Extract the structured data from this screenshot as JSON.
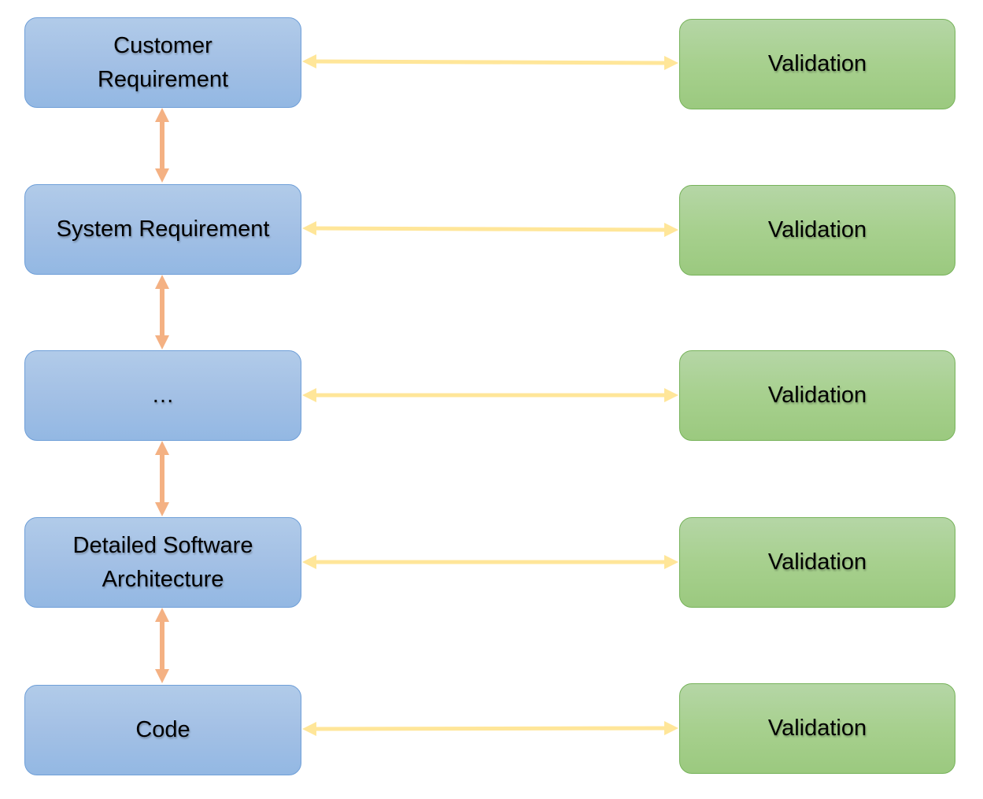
{
  "diagram": {
    "left_column": [
      {
        "label": "Customer\nRequirement"
      },
      {
        "label": "System Requirement"
      },
      {
        "label": "…"
      },
      {
        "label": "Detailed Software\nArchitecture"
      },
      {
        "label": "Code"
      }
    ],
    "right_column": [
      {
        "label": "Validation"
      },
      {
        "label": "Validation"
      },
      {
        "label": "Validation"
      },
      {
        "label": "Validation"
      },
      {
        "label": "Validation"
      }
    ],
    "connections": {
      "vertical": "bidirectional between consecutive left-column boxes",
      "horizontal": "bidirectional between each left box and its Validation box"
    },
    "colors": {
      "left_box_fill": "#a3c0e5",
      "left_box_border": "#6f9fd8",
      "right_box_fill": "#a7d08e",
      "right_box_border": "#77b35a",
      "vertical_arrow": "#f4b183",
      "horizontal_arrow": "#ffe699"
    }
  }
}
